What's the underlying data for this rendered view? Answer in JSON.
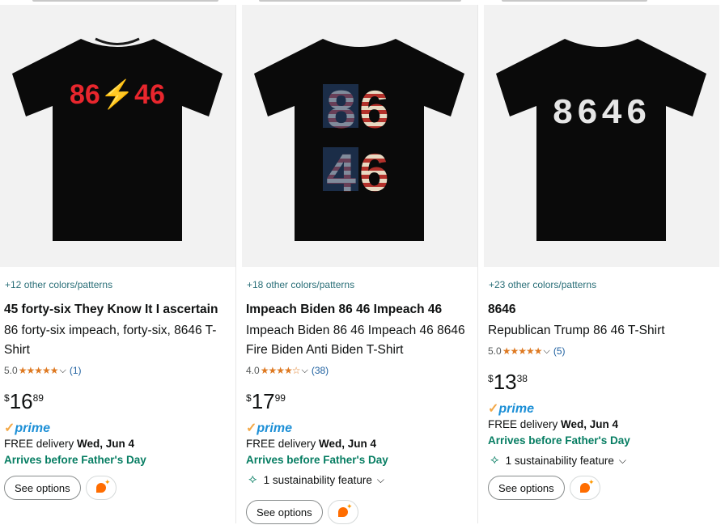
{
  "products": [
    {
      "design": "86⚡46",
      "design_color": "#e8262d",
      "colors_text": "+12 other colors/patterns",
      "title": "45 forty-six They Know It I ascertain",
      "subtitle": "86 forty-six impeach, forty-six, 8646 T-Shirt",
      "rating": "5.0",
      "rating_value": 5.0,
      "stars": "★★★★★",
      "reviews": "(1)",
      "price_symbol": "$",
      "price_whole": "16",
      "price_fraction": "89",
      "prime_check": "✓",
      "prime_label": "prime",
      "delivery_prefix": "FREE delivery",
      "delivery_date": "Wed, Jun 4",
      "fathers_day": "Arrives before Father's Day",
      "sustainability": "",
      "see_options": "See options"
    },
    {
      "design": "86 46",
      "colors_text": "+18 other colors/patterns",
      "title": "Impeach Biden 86 46 Impeach 46",
      "subtitle": "Impeach Biden 86 46 Impeach 46 8646 Fire Biden Anti Biden T-Shirt",
      "rating": "4.0",
      "rating_value": 4.0,
      "stars": "★★★★☆",
      "reviews": "(38)",
      "price_symbol": "$",
      "price_whole": "17",
      "price_fraction": "99",
      "prime_check": "✓",
      "prime_label": "prime",
      "delivery_prefix": "FREE delivery",
      "delivery_date": "Wed, Jun 4",
      "fathers_day": "Arrives before Father's Day",
      "sustainability": "1 sustainability feature",
      "see_options": "See options"
    },
    {
      "design": "8646",
      "design_color": "#e6e6e6",
      "colors_text": "+23 other colors/patterns",
      "title": "8646",
      "subtitle": "Republican Trump 86 46 T-Shirt",
      "rating": "5.0",
      "rating_value": 5.0,
      "stars": "★★★★★",
      "reviews": "(5)",
      "price_symbol": "$",
      "price_whole": "13",
      "price_fraction": "38",
      "prime_check": "✓",
      "prime_label": "prime",
      "delivery_prefix": "FREE delivery",
      "delivery_date": "Wed, Jun 4",
      "fathers_day": "Arrives before Father's Day",
      "sustainability": "1 sustainability feature",
      "see_options": "See options"
    }
  ],
  "icons": {
    "chevron": "chevron-down-icon",
    "leaf": "leaf-icon",
    "rufus": "rufus-ai-icon"
  },
  "colors": {
    "link": "#2a6f78",
    "reviews": "#2162a1",
    "star": "#de7921",
    "prime": "#1c8fd6",
    "green": "#067d62"
  }
}
